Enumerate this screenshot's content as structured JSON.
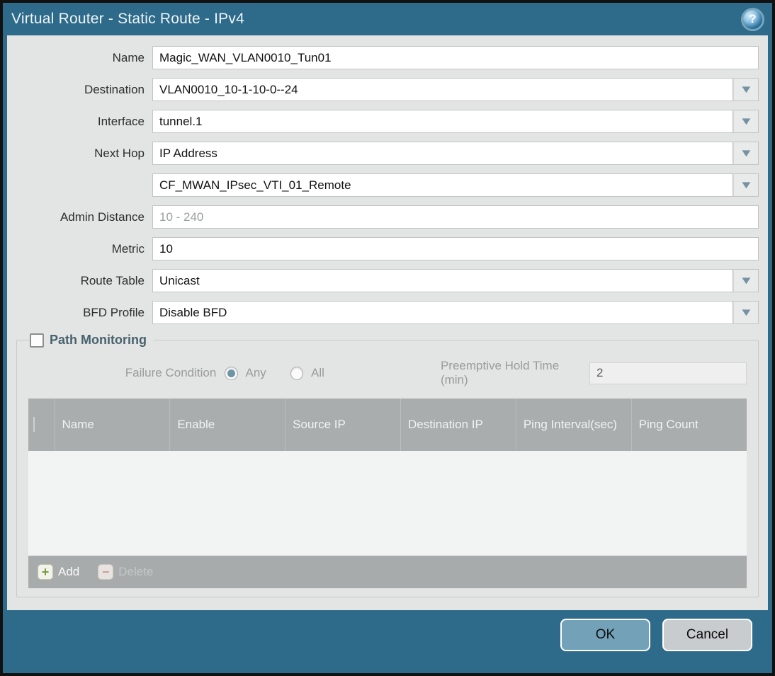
{
  "dialog": {
    "title": "Virtual Router - Static Route - IPv4"
  },
  "icons": {
    "help": "?",
    "dropdown": "▼",
    "add_plus": "+",
    "delete_minus": "−"
  },
  "fields": {
    "name": {
      "label": "Name",
      "value": "Magic_WAN_VLAN0010_Tun01"
    },
    "destination": {
      "label": "Destination",
      "value": "VLAN0010_10-1-10-0--24"
    },
    "interface": {
      "label": "Interface",
      "value": "tunnel.1"
    },
    "next_hop": {
      "label": "Next Hop",
      "value": "IP Address"
    },
    "next_hop_address": {
      "value": "CF_MWAN_IPsec_VTI_01_Remote"
    },
    "admin_distance": {
      "label": "Admin Distance",
      "value": "",
      "placeholder": "10 - 240"
    },
    "metric": {
      "label": "Metric",
      "value": "10"
    },
    "route_table": {
      "label": "Route Table",
      "value": "Unicast"
    },
    "bfd_profile": {
      "label": "BFD Profile",
      "value": "Disable BFD"
    }
  },
  "path_monitoring": {
    "title": "Path Monitoring",
    "checked": false,
    "failure_condition": {
      "label": "Failure Condition",
      "options": [
        {
          "label": "Any",
          "selected": true
        },
        {
          "label": "All",
          "selected": false
        }
      ]
    },
    "preemptive_hold": {
      "label": "Preemptive Hold Time (min)",
      "value": "2"
    },
    "table": {
      "columns": [
        "Name",
        "Enable",
        "Source IP",
        "Destination IP",
        "Ping Interval(sec)",
        "Ping Count"
      ],
      "rows": []
    },
    "toolbar": {
      "add_label": "Add",
      "delete_label": "Delete",
      "delete_enabled": false
    }
  },
  "footer": {
    "ok_label": "OK",
    "cancel_label": "Cancel"
  },
  "colors": {
    "titlebar_teal": "#2e6b8b",
    "content_bg": "#e3e4e4",
    "table_header_bg": "#a9adad",
    "ok_button_bg": "#73a2b8",
    "cancel_button_bg": "#c9cccf",
    "radio_dot": "#6e94a6",
    "add_icon_green": "#7b9c3a"
  }
}
